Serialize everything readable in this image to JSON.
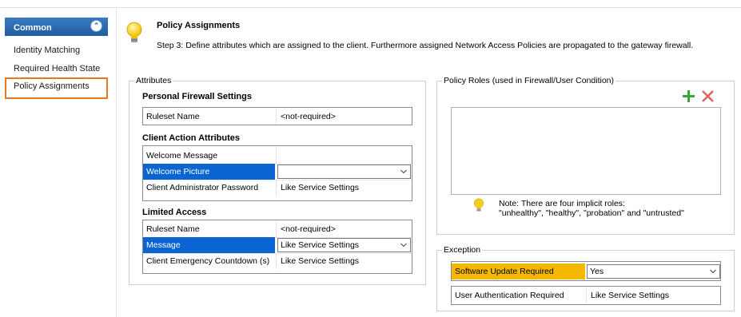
{
  "sidebar": {
    "header": "Common",
    "items": [
      {
        "label": "Identity Matching"
      },
      {
        "label": "Required Health State"
      },
      {
        "label": "Policy Assignments"
      }
    ]
  },
  "page": {
    "title": "Policy Assignments",
    "description": "Step 3: Define attributes which are assigned to the client. Furthermore assigned Network Access Policies are propagated to the gateway firewall."
  },
  "attributes": {
    "group_title": "Attributes",
    "personal_firewall": {
      "title": "Personal Firewall Settings",
      "rows": [
        {
          "label": "Ruleset Name",
          "value": "<not-required>"
        }
      ]
    },
    "client_action": {
      "title": "Client Action Attributes",
      "rows": [
        {
          "label": "Welcome Message",
          "value": ""
        },
        {
          "label": "Welcome Picture",
          "value": ""
        },
        {
          "label": "Client Administrator Password",
          "value": "Like Service Settings"
        }
      ]
    },
    "limited_access": {
      "title": "Limited Access",
      "rows": [
        {
          "label": "Ruleset Name",
          "value": "<not-required>"
        },
        {
          "label": "Message",
          "value": "Like Service Settings"
        },
        {
          "label": "Client Emergency Countdown (s)",
          "value": "Like Service Settings"
        }
      ]
    }
  },
  "policy_roles": {
    "group_title": "Policy Roles (used in Firewall/User Condition)",
    "note_line1": "Note: There are four implicit roles:",
    "note_line2": "\"unhealthy\", \"healthy\", \"probation\" and \"untrusted\""
  },
  "exception": {
    "group_title": "Exception",
    "rows": [
      {
        "label": "Software Update Required",
        "value": "Yes"
      },
      {
        "label": "User Authentication Required",
        "value": "Like Service Settings"
      }
    ]
  },
  "colors": {
    "accent_blue": "#0a64d2",
    "sidebar_header": "#2b6cb0",
    "selection_border": "#e87722",
    "warning_highlight": "#f5b800",
    "add_green": "#3aa53a",
    "delete_red": "#e06060"
  },
  "icons": [
    "chevron-up-icon",
    "lightbulb-icon",
    "add-icon",
    "delete-icon",
    "dropdown-arrow-icon"
  ]
}
